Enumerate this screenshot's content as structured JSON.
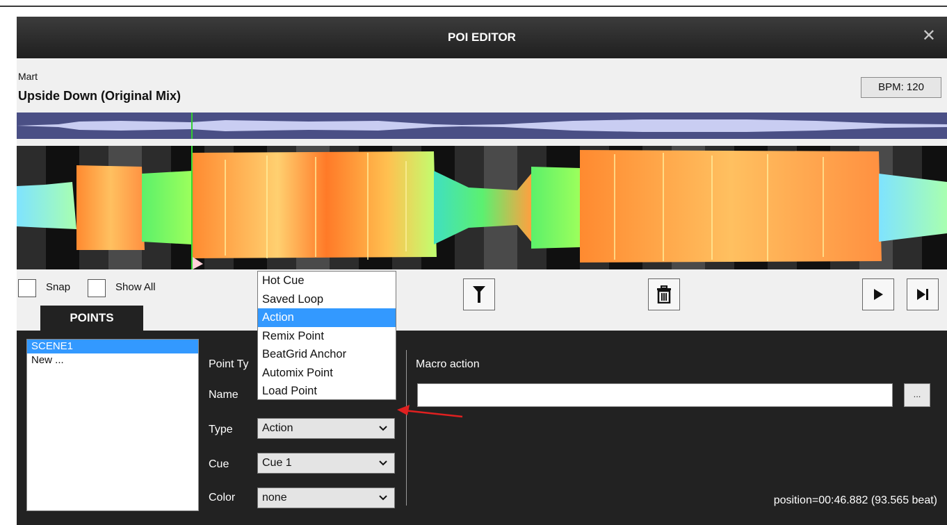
{
  "dialog": {
    "title": "POI EDITOR",
    "close_icon": "close-icon"
  },
  "track": {
    "artist": "Mart",
    "title": "Upside Down (Original Mix)",
    "bpm": "BPM: 120"
  },
  "controls": {
    "snap_label": "Snap",
    "show_all_label": "Show All",
    "filter_icon": "filter-icon",
    "delete_icon": "trash-icon",
    "play_icon": "play-icon",
    "next_icon": "skip-next-icon"
  },
  "points_tab": {
    "label": "POINTS"
  },
  "points_list": [
    {
      "label": "SCENE1",
      "selected": true
    },
    {
      "label": "New ...",
      "selected": false
    }
  ],
  "form": {
    "point_type_label": "Point Ty",
    "name_label": "Name",
    "type_label": "Type",
    "type_value": "Action",
    "cue_label": "Cue",
    "cue_value": "Cue 1",
    "color_label": "Color",
    "color_value": "none"
  },
  "type_dropdown": {
    "options": [
      {
        "label": "Hot Cue",
        "selected": false
      },
      {
        "label": "Saved Loop",
        "selected": false
      },
      {
        "label": "Action",
        "selected": true
      },
      {
        "label": "Remix Point",
        "selected": false
      },
      {
        "label": "BeatGrid Anchor",
        "selected": false
      },
      {
        "label": "Automix Point",
        "selected": false
      },
      {
        "label": "Load Point",
        "selected": false
      }
    ]
  },
  "macro": {
    "label": "Macro action",
    "value": "",
    "browse_label": "..."
  },
  "status": {
    "position": "position=00:46.882 (93.565 beat)"
  },
  "colors": {
    "titlebar": "#2a2a2a",
    "panel": "#222222",
    "selection": "#3399ff",
    "overview": "#4a4f85",
    "annotation_arrow": "#e02020"
  }
}
